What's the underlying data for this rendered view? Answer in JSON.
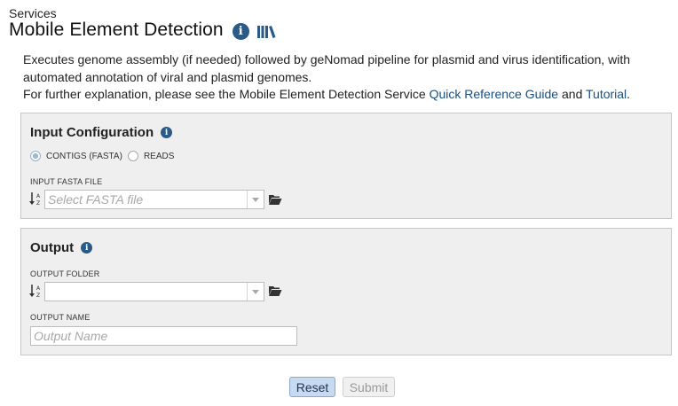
{
  "breadcrumb": "Services",
  "page": {
    "title": "Mobile Element Detection",
    "description_line1": "Executes genome assembly (if needed) followed by geNomad pipeline for plasmid and virus identification, with automated annotation of viral and plasmid genomes.",
    "description_line2_prefix": "For further explanation, please see the Mobile Element Detection Service ",
    "quick_reference_link": "Quick Reference Guide",
    "and_text": " and ",
    "tutorial_link": "Tutorial",
    "period": "."
  },
  "input_config": {
    "title": "Input Configuration",
    "radio_options": [
      {
        "label": "CONTIGS (FASTA)",
        "checked": true
      },
      {
        "label": "READS",
        "checked": false
      }
    ],
    "fasta_label": "INPUT FASTA FILE",
    "fasta_placeholder": "Select FASTA file"
  },
  "output": {
    "title": "Output",
    "folder_label": "OUTPUT FOLDER",
    "folder_value": "",
    "name_label": "OUTPUT NAME",
    "name_placeholder": "Output Name"
  },
  "buttons": {
    "reset": "Reset",
    "submit": "Submit"
  },
  "colors": {
    "info_icon": "#2a5a88",
    "link": "#1a4e7e",
    "panel_bg": "#efefef",
    "reset_bg": "#c7daf2"
  },
  "icons": [
    "info-icon",
    "library-books-icon",
    "sort-alpha-icon",
    "folder-open-icon",
    "dropdown-arrow-icon"
  ]
}
